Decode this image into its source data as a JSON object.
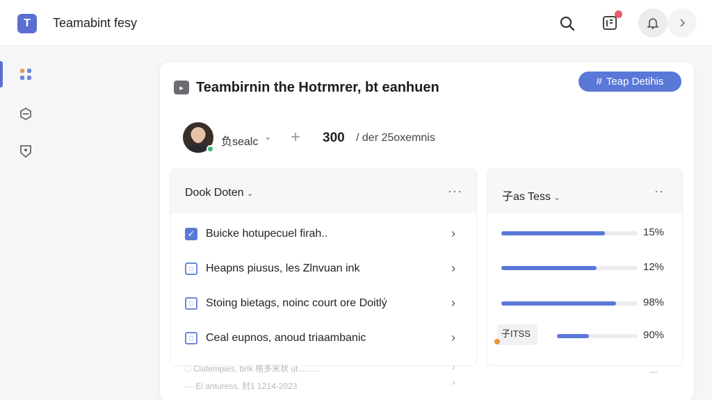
{
  "app": {
    "logo_letter": "T",
    "title": "Teamabint fesy"
  },
  "card": {
    "title": "Teambirnin the Hotrmrer, bt eanhuen",
    "team_button": "Teap Detihis",
    "user_name": "负sealc",
    "stat_value": "300",
    "stat_text": "/ der 25oxemnis"
  },
  "tasks_panel": {
    "title": "Dook Doten",
    "tasks": [
      {
        "label": "Buicke hotupecuel firah..",
        "checked": true
      },
      {
        "label": "Heapns piusus, les Zlnvuan ink",
        "checked": false
      },
      {
        "label": "Stoing bietags, noinc court ore Doitlý",
        "checked": false
      },
      {
        "label": "Ceal eupnos, anoud triaambanic",
        "checked": false
      }
    ],
    "faded_rows": [
      "Ciatempies, brik 格多米状 ut.........",
      "Ei anturess. 封1 1214-2023"
    ]
  },
  "progress_panel": {
    "title": "子as Tess",
    "items": [
      {
        "percent": 0.76,
        "label": "15%"
      },
      {
        "percent": 0.7,
        "label": "12%"
      },
      {
        "percent": 0.84,
        "label": "98%"
      },
      {
        "percent": 0.4,
        "label": "90%",
        "tag": "子ITSS"
      }
    ]
  },
  "colors": {
    "accent": "#5a78d8",
    "online": "#3db66a",
    "notification": "#e8606a"
  }
}
